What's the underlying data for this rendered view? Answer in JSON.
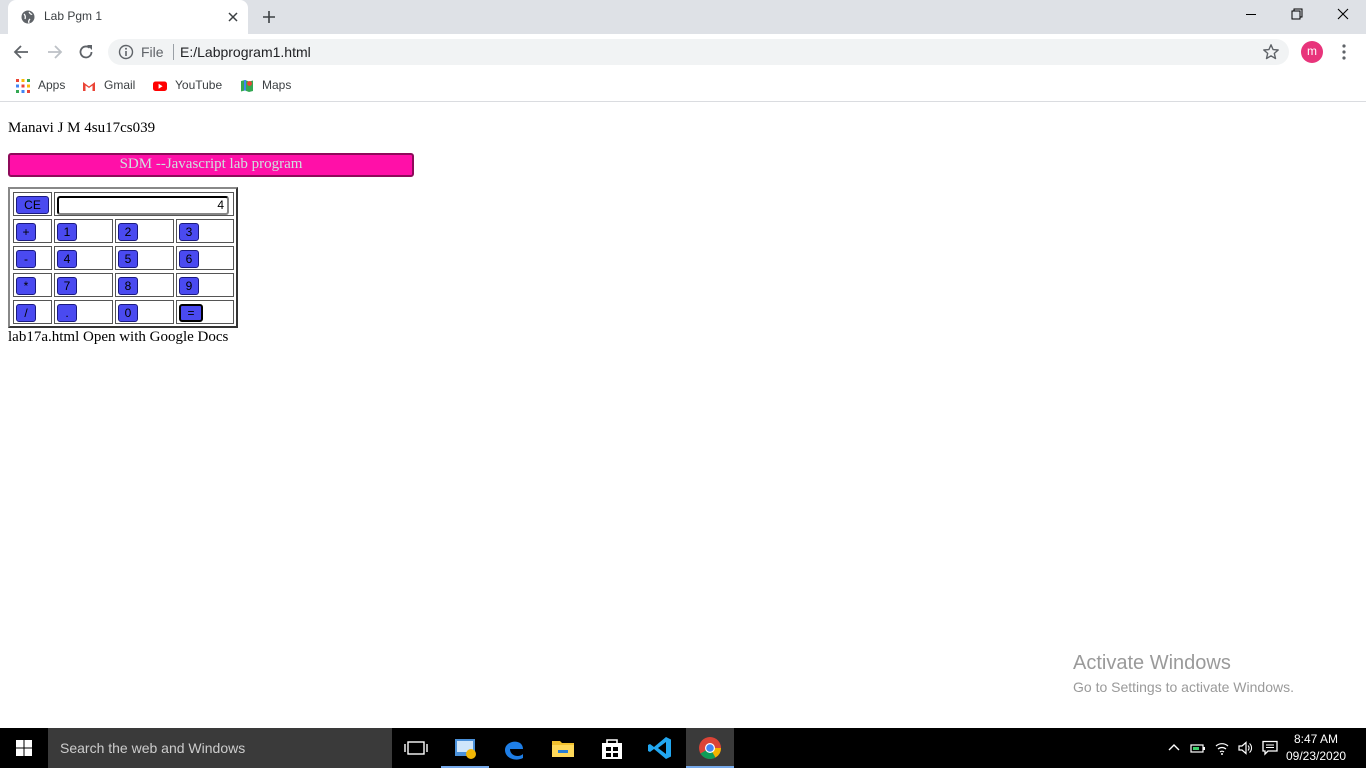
{
  "browser": {
    "tab_title": "Lab Pgm 1",
    "url_scheme_label": "File",
    "url": "E:/Labprogram1.html",
    "profile_initial": "m"
  },
  "bookmarks": [
    {
      "label": "Apps",
      "icon": "apps-grid-icon"
    },
    {
      "label": "Gmail",
      "icon": "gmail-icon"
    },
    {
      "label": "YouTube",
      "icon": "youtube-icon"
    },
    {
      "label": "Maps",
      "icon": "maps-icon"
    }
  ],
  "page": {
    "author": "Manavi J M 4su17cs039",
    "banner": "SDM --Javascript lab program",
    "footer": "lab17a.html Open with Google Docs"
  },
  "calculator": {
    "clear_label": "CE",
    "display_value": "4",
    "rows": [
      [
        "+",
        "1",
        "2",
        "3"
      ],
      [
        "-",
        "4",
        "5",
        "6"
      ],
      [
        "*",
        "7",
        "8",
        "9"
      ],
      [
        "/",
        ".",
        "0",
        "="
      ]
    ]
  },
  "watermark": {
    "title": "Activate Windows",
    "subtitle": "Go to Settings to activate Windows."
  },
  "taskbar": {
    "search_placeholder": "Search the web and Windows",
    "time": "8:47 AM",
    "date": "09/23/2020"
  },
  "colors": {
    "banner_bg": "#ff10a8",
    "key_bg": "#4a4af0",
    "avatar_bg": "#e8347b"
  }
}
